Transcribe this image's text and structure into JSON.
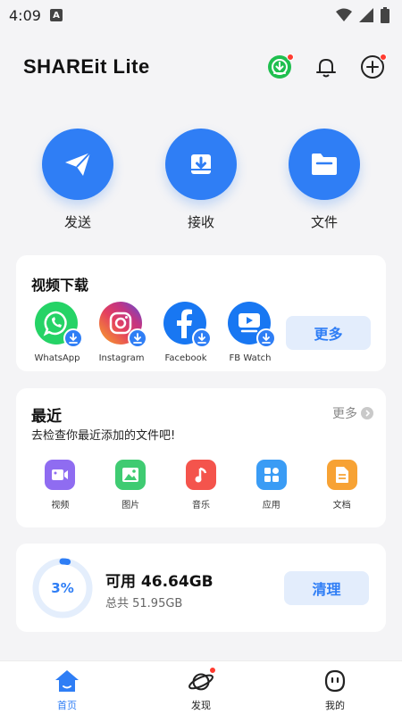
{
  "status_bar": {
    "time": "4:09",
    "notification_letter": "A",
    "icons": [
      "wifi-icon",
      "signal-icon",
      "battery-icon"
    ]
  },
  "header": {
    "title": "SHAREit Lite",
    "icons": [
      "download-manager-icon",
      "bell-icon",
      "add-icon"
    ]
  },
  "quick_actions": [
    {
      "label": "发送",
      "icon": "send-icon"
    },
    {
      "label": "接收",
      "icon": "receive-icon"
    },
    {
      "label": "文件",
      "icon": "folder-icon"
    }
  ],
  "video_download": {
    "title": "视频下载",
    "platforms": [
      {
        "name": "WhatsApp",
        "icon": "whatsapp-icon"
      },
      {
        "name": "Instagram",
        "icon": "instagram-icon"
      },
      {
        "name": "Facebook",
        "icon": "facebook-icon"
      },
      {
        "name": "FB Watch",
        "icon": "fb-watch-icon"
      }
    ],
    "more_label": "更多"
  },
  "recent": {
    "title": "最近",
    "more_label": "更多",
    "subtitle": "去检查你最近添加的文件吧!",
    "categories": [
      {
        "label": "视频",
        "icon": "video-icon",
        "color": "#8f6cf1"
      },
      {
        "label": "图片",
        "icon": "image-icon",
        "color": "#3fcb72"
      },
      {
        "label": "音乐",
        "icon": "music-icon",
        "color": "#f4544c"
      },
      {
        "label": "应用",
        "icon": "apps-icon",
        "color": "#3a9cf5"
      },
      {
        "label": "文档",
        "icon": "document-icon",
        "color": "#f7a234"
      }
    ]
  },
  "storage": {
    "percent_label": "3%",
    "used_fraction": 0.03,
    "available": "可用 46.64GB",
    "total": "总共 51.95GB",
    "clean_label": "清理"
  },
  "bottom_nav": [
    {
      "label": "首页",
      "icon": "home-icon",
      "active": true
    },
    {
      "label": "发现",
      "icon": "discover-icon",
      "active": false
    },
    {
      "label": "我的",
      "icon": "profile-icon",
      "active": false
    }
  ],
  "colors": {
    "accent": "#2f7ef5",
    "background": "#f4f4f6",
    "badge_red": "#ff3b30"
  }
}
